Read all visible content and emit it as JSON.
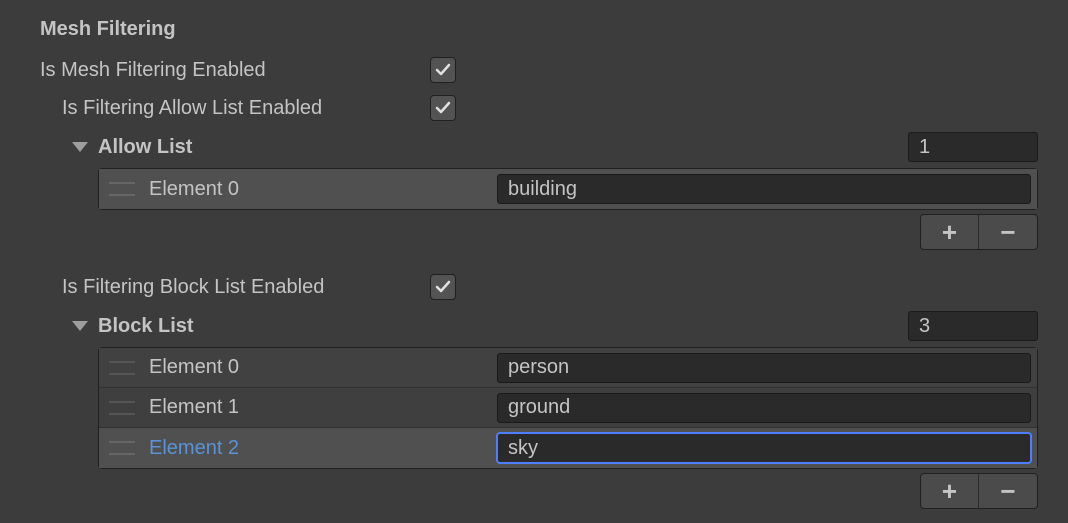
{
  "section": {
    "title": "Mesh Filtering",
    "isMeshFilteringEnabled": {
      "label": "Is Mesh Filtering Enabled",
      "checked": true
    },
    "isFilteringAllowListEnabled": {
      "label": "Is Filtering Allow List Enabled",
      "checked": true
    },
    "allowList": {
      "name": "Allow List",
      "count": "1",
      "elements": [
        {
          "label": "Element 0",
          "value": "building",
          "selected": true,
          "focused": false
        }
      ]
    },
    "isFilteringBlockListEnabled": {
      "label": "Is Filtering Block List Enabled",
      "checked": true
    },
    "blockList": {
      "name": "Block List",
      "count": "3",
      "elements": [
        {
          "label": "Element 0",
          "value": "person",
          "selected": false,
          "focused": false
        },
        {
          "label": "Element 1",
          "value": "ground",
          "selected": false,
          "focused": false
        },
        {
          "label": "Element 2",
          "value": "sky",
          "selected": true,
          "focused": true
        }
      ]
    }
  },
  "icons": {
    "plus": "+",
    "minus": "−"
  }
}
